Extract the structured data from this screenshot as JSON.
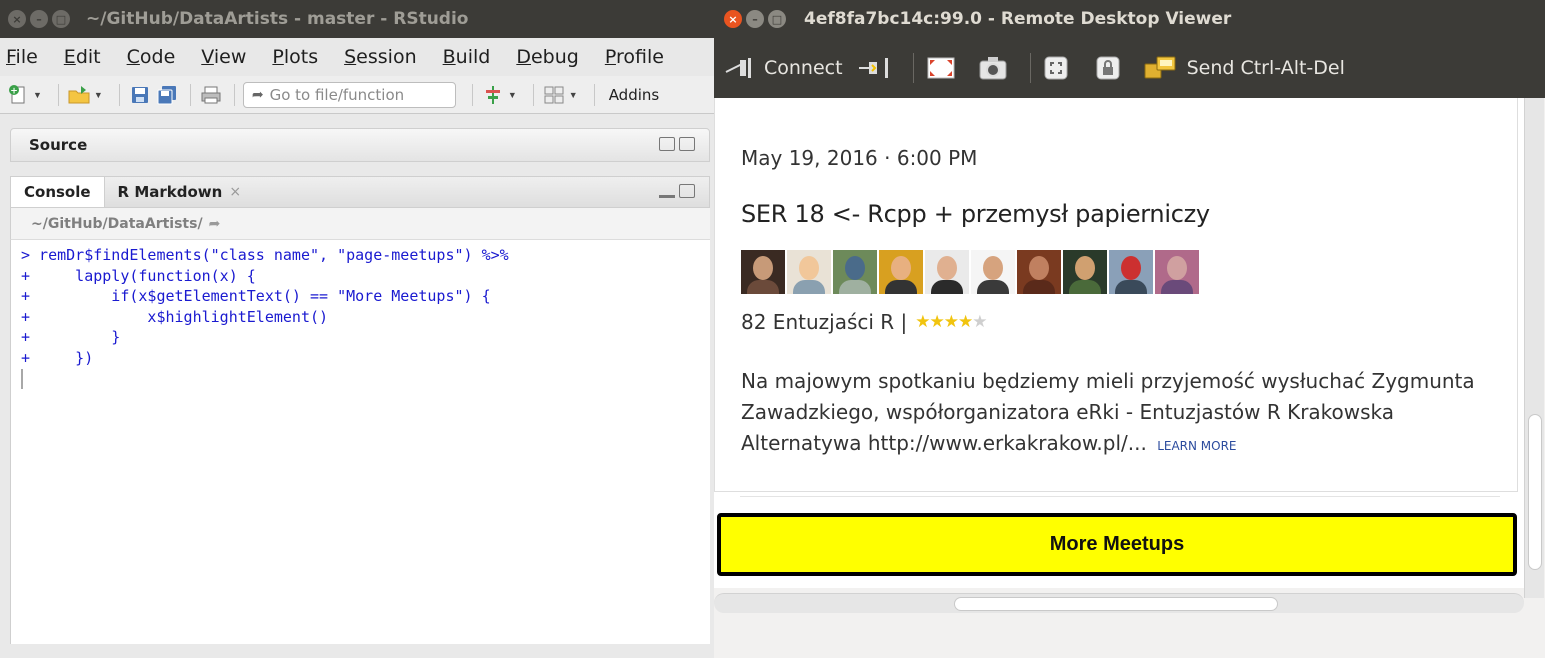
{
  "rstudio": {
    "window_title": "~/GitHub/DataArtists - master - RStudio",
    "menu": [
      {
        "label": "File",
        "ul": "F",
        "rest": "ile"
      },
      {
        "label": "Edit",
        "ul": "E",
        "rest": "dit"
      },
      {
        "label": "Code",
        "ul": "C",
        "rest": "ode"
      },
      {
        "label": "View",
        "ul": "V",
        "rest": "iew"
      },
      {
        "label": "Plots",
        "ul": "P",
        "rest": "lots"
      },
      {
        "label": "Session",
        "ul": "S",
        "rest": "ession"
      },
      {
        "label": "Build",
        "ul": "B",
        "rest": "uild"
      },
      {
        "label": "Debug",
        "ul": "D",
        "rest": "ebug"
      },
      {
        "label": "Profile",
        "ul": "P",
        "rest": "rofile"
      }
    ],
    "toolbar": {
      "goto_placeholder": "Go to file/function",
      "addins_label": "Addins"
    },
    "source_pane_title": "Source",
    "console_tabs": [
      {
        "label": "Console",
        "active": true
      },
      {
        "label": "R Markdown",
        "active": false,
        "close": "×"
      }
    ],
    "console_path": "~/GitHub/DataArtists/",
    "console_lines": [
      "> remDr$findElements(\"class name\", \"page-meetups\") %>%",
      "+     lapply(function(x) {",
      "+         if(x$getElementText() == \"More Meetups\") {",
      "+             x$highlightElement()",
      "+         }",
      "+     })"
    ]
  },
  "rdv": {
    "window_title": "4ef8fa7bc14c:99.0 - Remote Desktop Viewer",
    "toolbar": {
      "connect_label": "Connect",
      "send_cad_label": "Send Ctrl-Alt-Del"
    }
  },
  "meetup": {
    "date": "May 19, 2016 · 6:00 PM",
    "title": "SER 18 <- Rcpp + przemysł papierniczy",
    "members": "82 Entuzjaści R |",
    "rating": 4,
    "rating_max": 5,
    "description": "Na majowym spotkaniu będziemy mieli przyjemość wysłuchać Zygmunta Zawadzkiego, współorganizatora eRki - Entuzjastów R Krakowska Alternatywa http://www.erkakrakow.pl/...",
    "learn_more": "LEARN MORE",
    "more_button": "More Meetups"
  },
  "colors": {
    "ubuntu_titlebar": "#3c3b37",
    "ubuntu_close": "#e95420",
    "console_code": "#1a1ad0",
    "highlight_yellow": "#ffff00",
    "star": "#f1c40f",
    "learn_more_link": "#2c4c9e"
  },
  "icons": [
    "close-icon",
    "minimize-icon",
    "maximize-icon",
    "new-file-icon",
    "open-folder-icon",
    "save-icon",
    "save-all-icon",
    "print-icon",
    "goto-arrow-icon",
    "git-icon",
    "grid-icon",
    "connect-icon",
    "plug-icon",
    "fullscreen-icon",
    "screenshot-icon",
    "scale-icon",
    "lock-icon",
    "keyboard-icon"
  ]
}
